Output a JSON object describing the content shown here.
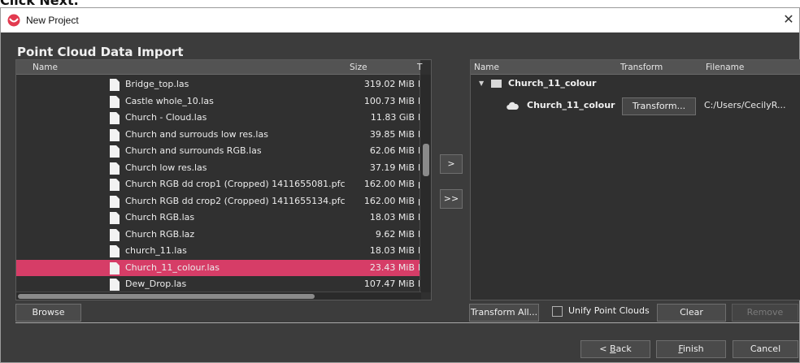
{
  "top_caption": {
    "prefix": "Click ",
    "bold": "Next."
  },
  "window": {
    "title": "New Project",
    "close_glyph": "✕"
  },
  "heading": "Point Cloud Data Import",
  "file_panel": {
    "columns": {
      "name": "Name",
      "size": "Size",
      "type": "T"
    },
    "rows": [
      {
        "name": "Bridge_top.las",
        "size": "319.02 MiB",
        "type": "la"
      },
      {
        "name": "Castle whole_10.las",
        "size": "100.73 MiB",
        "type": "la"
      },
      {
        "name": "Church - Cloud.las",
        "size": "11.83 GiB",
        "type": "la"
      },
      {
        "name": "Church and surrouds low res.las",
        "size": "39.85 MiB",
        "type": "la"
      },
      {
        "name": "Church and surrounds RGB.las",
        "size": "62.06 MiB",
        "type": "la"
      },
      {
        "name": "Church low res.las",
        "size": "37.19 MiB",
        "type": "la"
      },
      {
        "name": "Church RGB dd crop1 (Cropped) 1411655081.pfc",
        "size": "162.00 MiB",
        "type": "p"
      },
      {
        "name": "Church RGB dd crop2 (Cropped) 1411655134.pfc",
        "size": "162.00 MiB",
        "type": "p"
      },
      {
        "name": "Church RGB.las",
        "size": "18.03 MiB",
        "type": "la"
      },
      {
        "name": "Church RGB.laz",
        "size": "9.62 MiB",
        "type": "la"
      },
      {
        "name": "church_11.las",
        "size": "18.03 MiB",
        "type": "la"
      },
      {
        "name": "Church_11_colour.las",
        "size": "23.43 MiB",
        "type": "la",
        "selected": true
      },
      {
        "name": "Dew_Drop.las",
        "size": "107.47 MiB",
        "type": "la"
      }
    ]
  },
  "arrows": {
    "add": ">",
    "add_all": ">>"
  },
  "project_panel": {
    "columns": {
      "name": "Name",
      "transform": "Transform",
      "filename": "Filename"
    },
    "group": {
      "expander": "▼",
      "name": "Church_11_colour"
    },
    "item": {
      "name": "Church_11_colour",
      "transform_button": "Transform...",
      "filename": "C:/Users/CecilyR..."
    }
  },
  "buttons": {
    "browse": "Browse",
    "transform_all": "Transform All...",
    "unify_label": "Unify Point Clouds",
    "clear": "Clear",
    "remove": "Remove",
    "back_prefix": "< ",
    "back_key": "B",
    "back_rest": "ack",
    "finish_key": "F",
    "finish_rest": "inish",
    "cancel": "Cancel"
  },
  "colors": {
    "selected_row": "#d63d67",
    "background": "#3c3c3c"
  }
}
